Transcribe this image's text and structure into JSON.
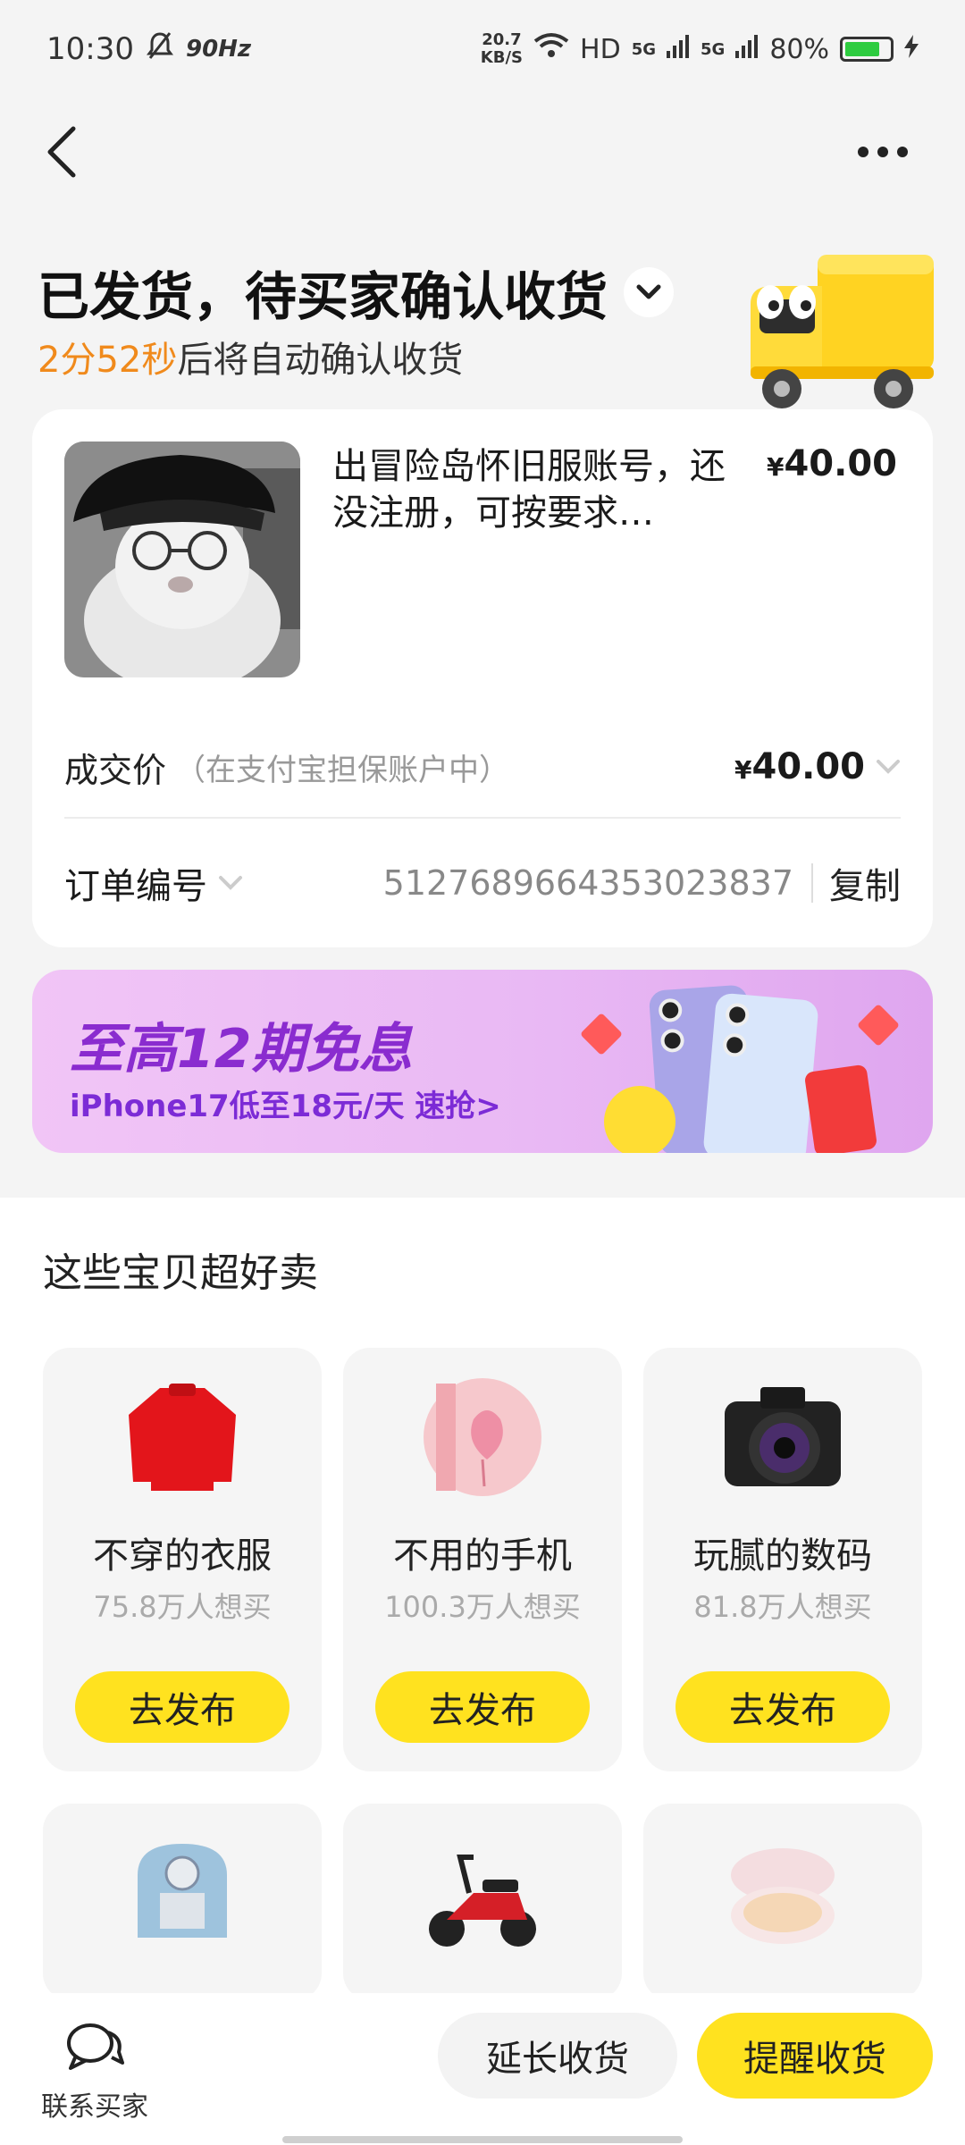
{
  "status_bar": {
    "time": "10:30",
    "refresh": "90Hz",
    "net_speed_value": "20.7",
    "net_speed_unit": "KB/S",
    "network": "HD",
    "signal_1": "5G",
    "signal_2": "5G",
    "battery": "80%",
    "battery_level": 0.8
  },
  "header": {
    "status_title": "已发货，待买家确认收货",
    "countdown_time": "2分52秒",
    "countdown_suffix": "后将自动确认收货"
  },
  "order": {
    "product_title": "出冒险岛怀旧服账号，还没注册，可按要求…",
    "price_symbol": "¥",
    "price": "40.00",
    "deal_label": "成交价",
    "deal_note": "（在支付宝担保账户中）",
    "deal_price": "40.00",
    "order_label": "订单编号",
    "order_number": "5127689664353023837",
    "copy_label": "复制"
  },
  "promo": {
    "title": "至高12期免息",
    "subtitle": "iPhone17低至18元/天  速抢>"
  },
  "recommendations": {
    "title": "这些宝贝超好卖",
    "items": [
      {
        "name": "不穿的衣服",
        "count": "75.8万人想买",
        "button": "去发布"
      },
      {
        "name": "不用的手机",
        "count": "100.3万人想买",
        "button": "去发布"
      },
      {
        "name": "玩腻的数码",
        "count": "81.8万人想买",
        "button": "去发布"
      }
    ]
  },
  "bottom_bar": {
    "contact_label": "联系买家",
    "extend_label": "延长收货",
    "remind_label": "提醒收货"
  },
  "colors": {
    "accent_yellow": "#ffe21f",
    "countdown_orange": "#f08a1c",
    "promo_purple": "#8a2ccf"
  }
}
